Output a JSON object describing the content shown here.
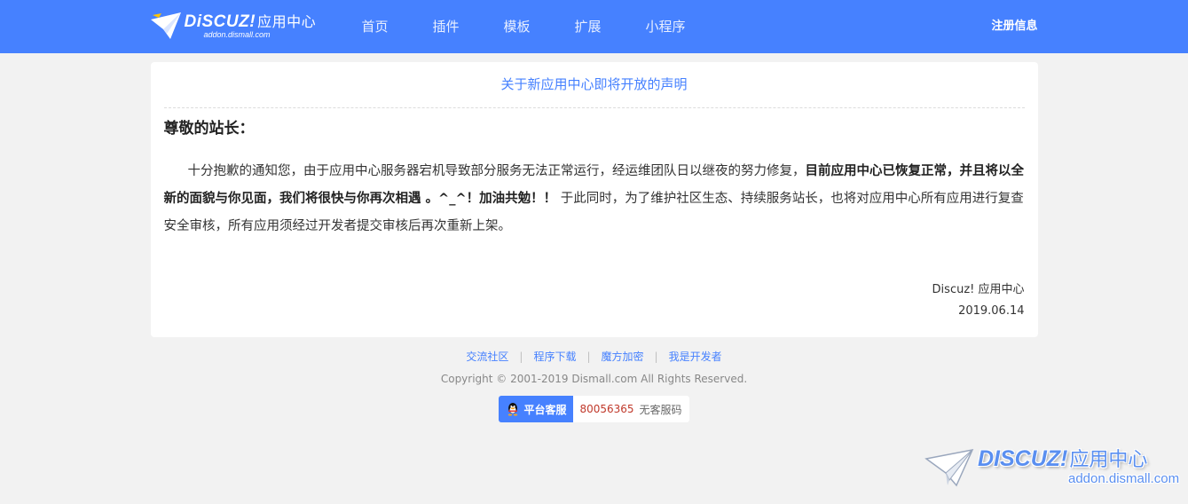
{
  "header": {
    "logo_brand": "DiSCUZ!",
    "logo_cn": "应用中心",
    "logo_sub": "addon.dismall.com",
    "nav": [
      "首页",
      "插件",
      "模板",
      "扩展",
      "小程序"
    ],
    "register_label": "注册信息",
    "bg_color": "#4681ff"
  },
  "notice": {
    "title": "关于新应用中心即将开放的声明",
    "greeting": "尊敬的站长：",
    "para_start": "十分抱歉的通知您，由于应用中心服务器宕机导致部分服务无法正常运行，经运维团队日以继夜的努力修复，",
    "para_bold": "目前应用中心已恢复正常，并且将以全新的面貌与你见面，我们将很快与你再次相遇 。^_^！加油共勉！！",
    "para_end": " 于此同时，为了维护社区生态、持续服务站长，也将对应用中心所有应用进行复查安全审核，所有应用须经过开发者提交审核后再次重新上架。",
    "sign_org": "Discuz! 应用中心",
    "sign_date": "2019.06.14"
  },
  "footer": {
    "links": [
      "交流社区",
      "程序下载",
      "魔方加密",
      "我是开发者"
    ],
    "separator": "|",
    "copyright": "Copyright © 2001-2019 Dismall.com All Rights Reserved.",
    "service_label": "平台客服",
    "service_number": "80056365",
    "service_desc": "无客服码"
  },
  "watermark": {
    "brand": "DISCUZ!",
    "cn": "应用中心",
    "sub": "addon.dismall.com"
  },
  "icons": [
    "paper-plane-logo-icon",
    "qq-penguin-icon"
  ]
}
